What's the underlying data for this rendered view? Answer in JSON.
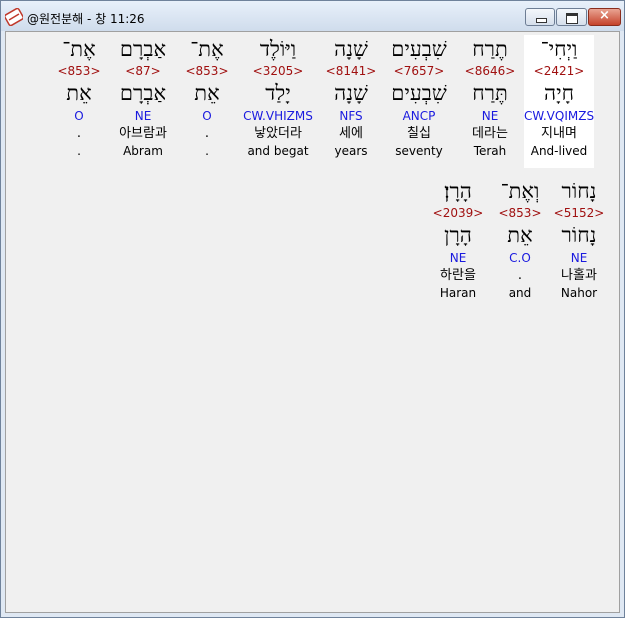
{
  "window": {
    "title": "@원전분해 - 창 11:26",
    "close_label": "×"
  },
  "rows": [
    {
      "words": [
        {
          "heb": "וַיְחִי־",
          "strong": "<2421>",
          "lex": "חָיָה",
          "parse": "CW.VQIMZS",
          "kor": "지내며",
          "eng": "And-lived",
          "highlight": true
        },
        {
          "heb": "תֶרַח",
          "strong": "<8646>",
          "lex": "תֶּרַח",
          "parse": "NE",
          "kor": "데라는",
          "eng": "Terah"
        },
        {
          "heb": "שִׁבְעִים",
          "strong": "<7657>",
          "lex": "שִׁבְעִים",
          "parse": "ANCP",
          "kor": "칠십",
          "eng": "seventy"
        },
        {
          "heb": "שָׁנָה",
          "strong": "<8141>",
          "lex": "שָׁנָה",
          "parse": "NFS",
          "kor": "세에",
          "eng": "years"
        },
        {
          "heb": "וַיּוֹלֶד",
          "strong": "<3205>",
          "lex": "יָלַד",
          "parse": "CW.VHIZMS",
          "kor": "낳았더라",
          "eng": "and begat"
        },
        {
          "heb": "אֶת־",
          "strong": "<853>",
          "lex": "אֵת",
          "parse": "O",
          "kor": ".",
          "eng": "."
        },
        {
          "heb": "אַבְרָם",
          "strong": "<87>",
          "lex": "אַבְרָם",
          "parse": "NE",
          "kor": "아브람과",
          "eng": "Abram"
        },
        {
          "heb": "אֶת־",
          "strong": "<853>",
          "lex": "אֵת",
          "parse": "O",
          "kor": ".",
          "eng": "."
        }
      ]
    },
    {
      "words": [
        {
          "heb": "נָחוֹר",
          "strong": "<5152>",
          "lex": "נָחוֹר",
          "parse": "NE",
          "kor": "나홀과",
          "eng": "Nahor"
        },
        {
          "heb": "וְאֶת־",
          "strong": "<853>",
          "lex": "אֵת",
          "parse": "C.O",
          "kor": ".",
          "eng": "and"
        },
        {
          "heb": "הָרָן׃",
          "strong": "<2039>",
          "lex": "הָרָן",
          "parse": "NE",
          "kor": "하란을",
          "eng": "Haran"
        }
      ]
    }
  ]
}
